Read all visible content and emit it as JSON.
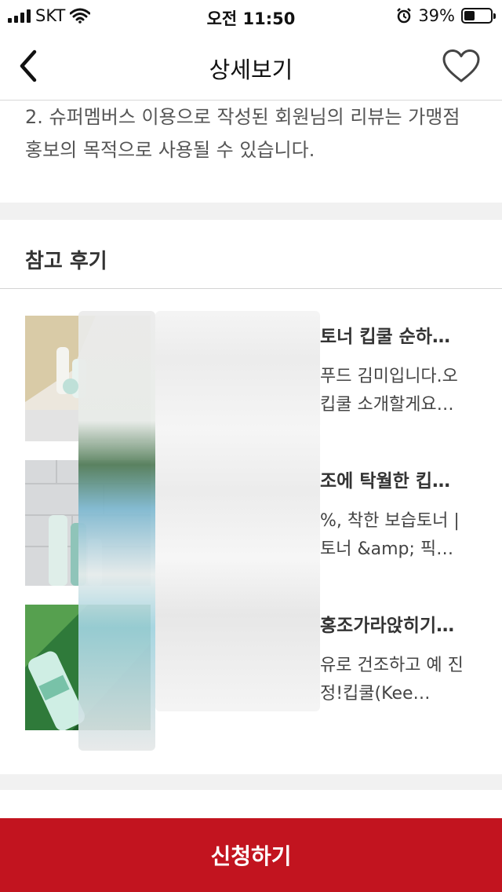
{
  "status_bar": {
    "carrier": "SKT",
    "time": "오전 11:50",
    "battery": "39%",
    "battery_level": 0.39
  },
  "nav": {
    "title": "상세보기",
    "back_icon": "chevron-left-icon",
    "favorite_icon": "heart-outline-icon"
  },
  "notice": {
    "text": "2. 슈퍼멤버스 이용으로 작성된 회원님의 리뷰는 가맹점 홍보의 목적으로 사용될 수 있습니다."
  },
  "reviews": {
    "title": "참고 후기",
    "items": [
      {
        "title": "토너 킵쿨 순하…",
        "body": "푸드 김미입니다.오 킵쿨 소개할게요…"
      },
      {
        "title": "조에 탁월한 킵…",
        "body": "%, 착한 보습토너 | 토너 &amp; 픽…"
      },
      {
        "title": "홍조가라앉히기…",
        "body": "유로 건조하고 예 진정!킵쿨(Kee…"
      }
    ]
  },
  "apply_button": {
    "label": "신청하기"
  },
  "colors": {
    "accent": "#c2141f",
    "divider": "#d8d8d8",
    "band": "#f1f1f1"
  }
}
